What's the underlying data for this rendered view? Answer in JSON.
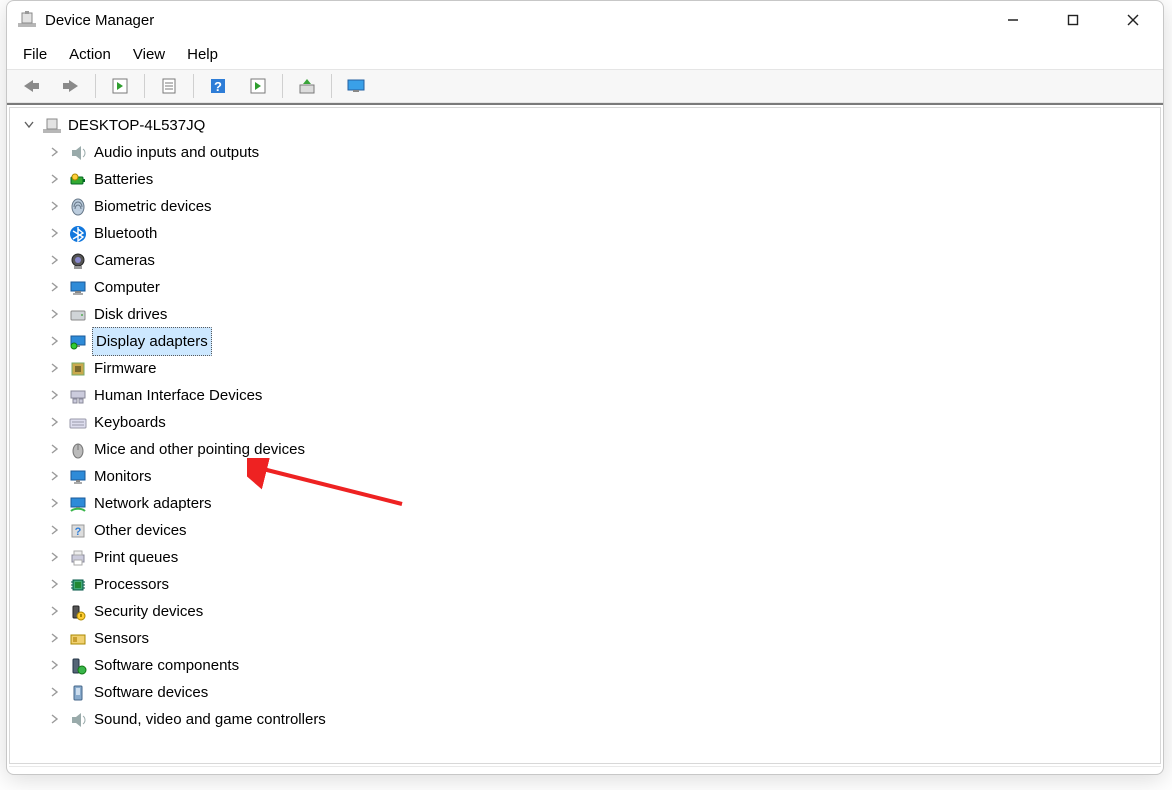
{
  "window": {
    "title": "Device Manager"
  },
  "menu": {
    "file": "File",
    "action": "Action",
    "view": "View",
    "help": "Help"
  },
  "toolbar": {
    "back": "Back",
    "forward": "Forward",
    "show_hidden": "Show hidden devices",
    "properties": "Properties",
    "help": "Help",
    "update_drivers": "Update drivers",
    "uninstall": "Uninstall device",
    "scan": "Scan for hardware changes"
  },
  "tree": {
    "root": "DESKTOP-4L537JQ",
    "items": [
      {
        "label": "Audio inputs and outputs",
        "icon": "speaker"
      },
      {
        "label": "Batteries",
        "icon": "battery"
      },
      {
        "label": "Biometric devices",
        "icon": "fingerprint"
      },
      {
        "label": "Bluetooth",
        "icon": "bluetooth"
      },
      {
        "label": "Cameras",
        "icon": "camera"
      },
      {
        "label": "Computer",
        "icon": "computer"
      },
      {
        "label": "Disk drives",
        "icon": "disk"
      },
      {
        "label": "Display adapters",
        "icon": "display",
        "selected": true
      },
      {
        "label": "Firmware",
        "icon": "firmware"
      },
      {
        "label": "Human Interface Devices",
        "icon": "hid"
      },
      {
        "label": "Keyboards",
        "icon": "keyboard"
      },
      {
        "label": "Mice and other pointing devices",
        "icon": "mouse"
      },
      {
        "label": "Monitors",
        "icon": "monitor"
      },
      {
        "label": "Network adapters",
        "icon": "network"
      },
      {
        "label": "Other devices",
        "icon": "other"
      },
      {
        "label": "Print queues",
        "icon": "printer"
      },
      {
        "label": "Processors",
        "icon": "processor"
      },
      {
        "label": "Security devices",
        "icon": "security"
      },
      {
        "label": "Sensors",
        "icon": "sensor"
      },
      {
        "label": "Software components",
        "icon": "swcomp"
      },
      {
        "label": "Software devices",
        "icon": "swdev"
      },
      {
        "label": "Sound, video and game controllers",
        "icon": "sound"
      }
    ]
  },
  "annotation": {
    "arrow_target": "Display adapters"
  }
}
